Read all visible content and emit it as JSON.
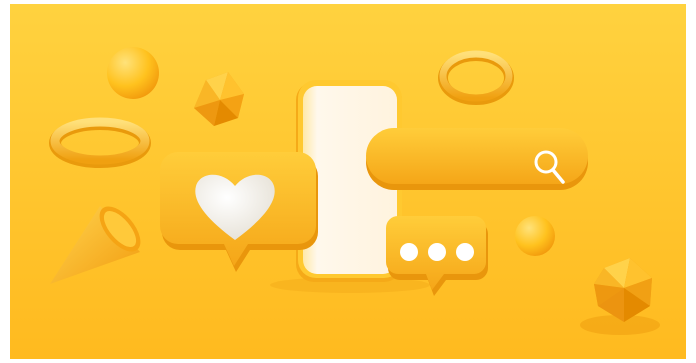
{
  "scene": {
    "description_label": "",
    "colors": {
      "background_light": "#FFD23F",
      "background_dark": "#FFB81A",
      "object_yellow": "#FFC21E",
      "object_orange": "#F7A414",
      "object_shadow": "#E48C00",
      "phone_screen": "#FFF6E4",
      "heart": "#F3F1EA",
      "dots": "#FFFFFF"
    },
    "icons": [
      "heart-icon",
      "search-icon",
      "ellipsis-dots-icon"
    ]
  }
}
